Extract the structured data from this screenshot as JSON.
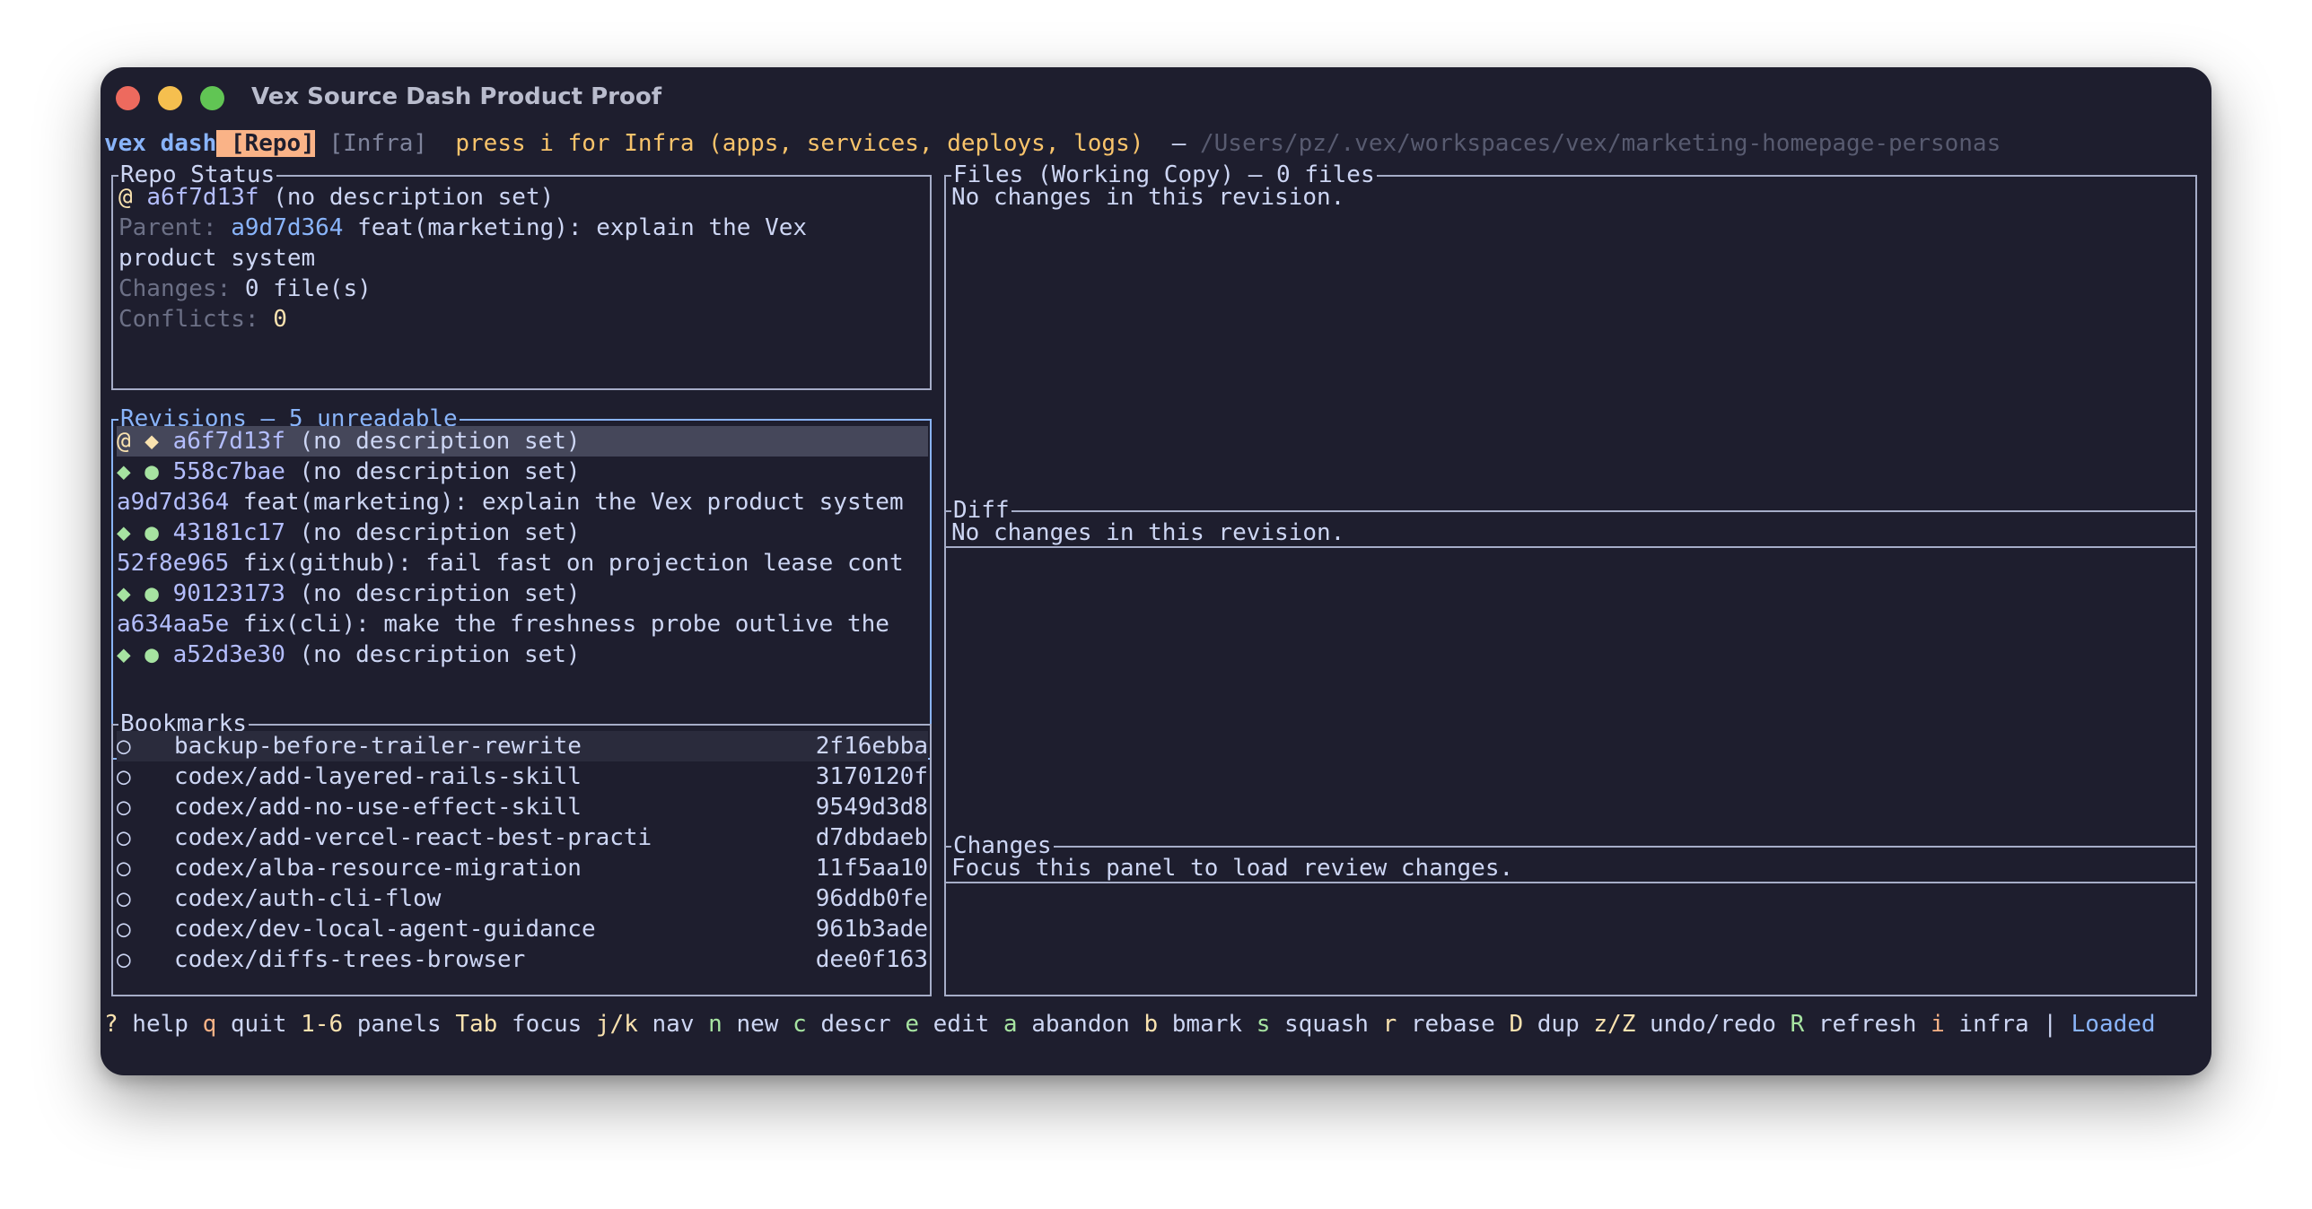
{
  "window": {
    "title": "Vex Source Dash Product Proof"
  },
  "header": {
    "app_name": "vex dash",
    "tab_repo": " [Repo]",
    "tab_infra": "[Infra]",
    "hint": "press i for Infra (apps, services, deploys, logs)",
    "separator": "—",
    "path": "/Users/pz/.vex/workspaces/vex/marketing-homepage-personas"
  },
  "repo_status": {
    "title": "Repo Status",
    "at": "@",
    "change_id": "a6f7d13f",
    "change_desc": "(no description set)",
    "parent_label": "Parent:",
    "parent_id": "a9d7d364",
    "parent_desc_1": "feat(marketing): explain the Vex",
    "parent_desc_2": "product system",
    "changes_label": "Changes:",
    "changes_value": "0 file(s)",
    "conflicts_label": "Conflicts:",
    "conflicts_value": "0"
  },
  "revisions": {
    "title": "Revisions — 5 unreadable",
    "rows": [
      {
        "prefix": "@ ◆ ",
        "id": "a6f7d13f",
        "desc": " (no description set)"
      },
      {
        "prefix": "◆ ● ",
        "id": "558c7bae",
        "desc": " (no description set)"
      },
      {
        "prefix": "",
        "id": "a9d7d364",
        "desc": " feat(marketing): explain the Vex product system"
      },
      {
        "prefix": "◆ ● ",
        "id": "43181c17",
        "desc": " (no description set)"
      },
      {
        "prefix": "",
        "id": "52f8e965",
        "desc": " fix(github): fail fast on projection lease cont"
      },
      {
        "prefix": "◆ ● ",
        "id": "90123173",
        "desc": " (no description set)"
      },
      {
        "prefix": "",
        "id": "a634aa5e",
        "desc": " fix(cli): make the freshness probe outlive the"
      },
      {
        "prefix": "◆ ● ",
        "id": "a52d3e30",
        "desc": " (no description set)"
      }
    ]
  },
  "bookmarks": {
    "title": "Bookmarks",
    "rows": [
      {
        "marker": "○",
        "name": "backup-before-trailer-rewrite",
        "hash": "2f16ebba"
      },
      {
        "marker": "○",
        "name": "codex/add-layered-rails-skill",
        "hash": "3170120f"
      },
      {
        "marker": "○",
        "name": "codex/add-no-use-effect-skill",
        "hash": "9549d3d8"
      },
      {
        "marker": "○",
        "name": "codex/add-vercel-react-best-practi",
        "hash": "d7dbdaeb"
      },
      {
        "marker": "○",
        "name": "codex/alba-resource-migration",
        "hash": "11f5aa10"
      },
      {
        "marker": "○",
        "name": "codex/auth-cli-flow",
        "hash": "96ddb0fe"
      },
      {
        "marker": "○",
        "name": "codex/dev-local-agent-guidance",
        "hash": "961b3ade"
      },
      {
        "marker": "○",
        "name": "codex/diffs-trees-browser",
        "hash": "dee0f163"
      }
    ]
  },
  "files": {
    "title": "Files (Working Copy) — 0 files",
    "body": "No changes in this revision."
  },
  "diff": {
    "title": "Diff",
    "body": "No changes in this revision."
  },
  "changes": {
    "title": "Changes",
    "body": "Focus this panel to load review changes."
  },
  "footer": {
    "items": [
      {
        "key": "?",
        "label": " help "
      },
      {
        "key": "q",
        "label": " quit "
      },
      {
        "key": "1-6",
        "label": " panels "
      },
      {
        "key": "Tab",
        "label": " focus "
      },
      {
        "key": "j/k",
        "label": " nav "
      },
      {
        "key": "n",
        "label": " new "
      },
      {
        "key": "c",
        "label": " descr "
      },
      {
        "key": "e",
        "label": " edit "
      },
      {
        "key": "a",
        "label": " abandon "
      },
      {
        "key": "b",
        "label": " bmark "
      },
      {
        "key": "s",
        "label": " squash "
      },
      {
        "key": "r",
        "label": " rebase "
      },
      {
        "key": "D",
        "label": " dup "
      },
      {
        "key": "z/Z",
        "label": " undo/redo "
      },
      {
        "key": "R",
        "label": " refresh "
      },
      {
        "key": "i",
        "label": " infra "
      }
    ],
    "divider": "| ",
    "status": "Loaded"
  }
}
